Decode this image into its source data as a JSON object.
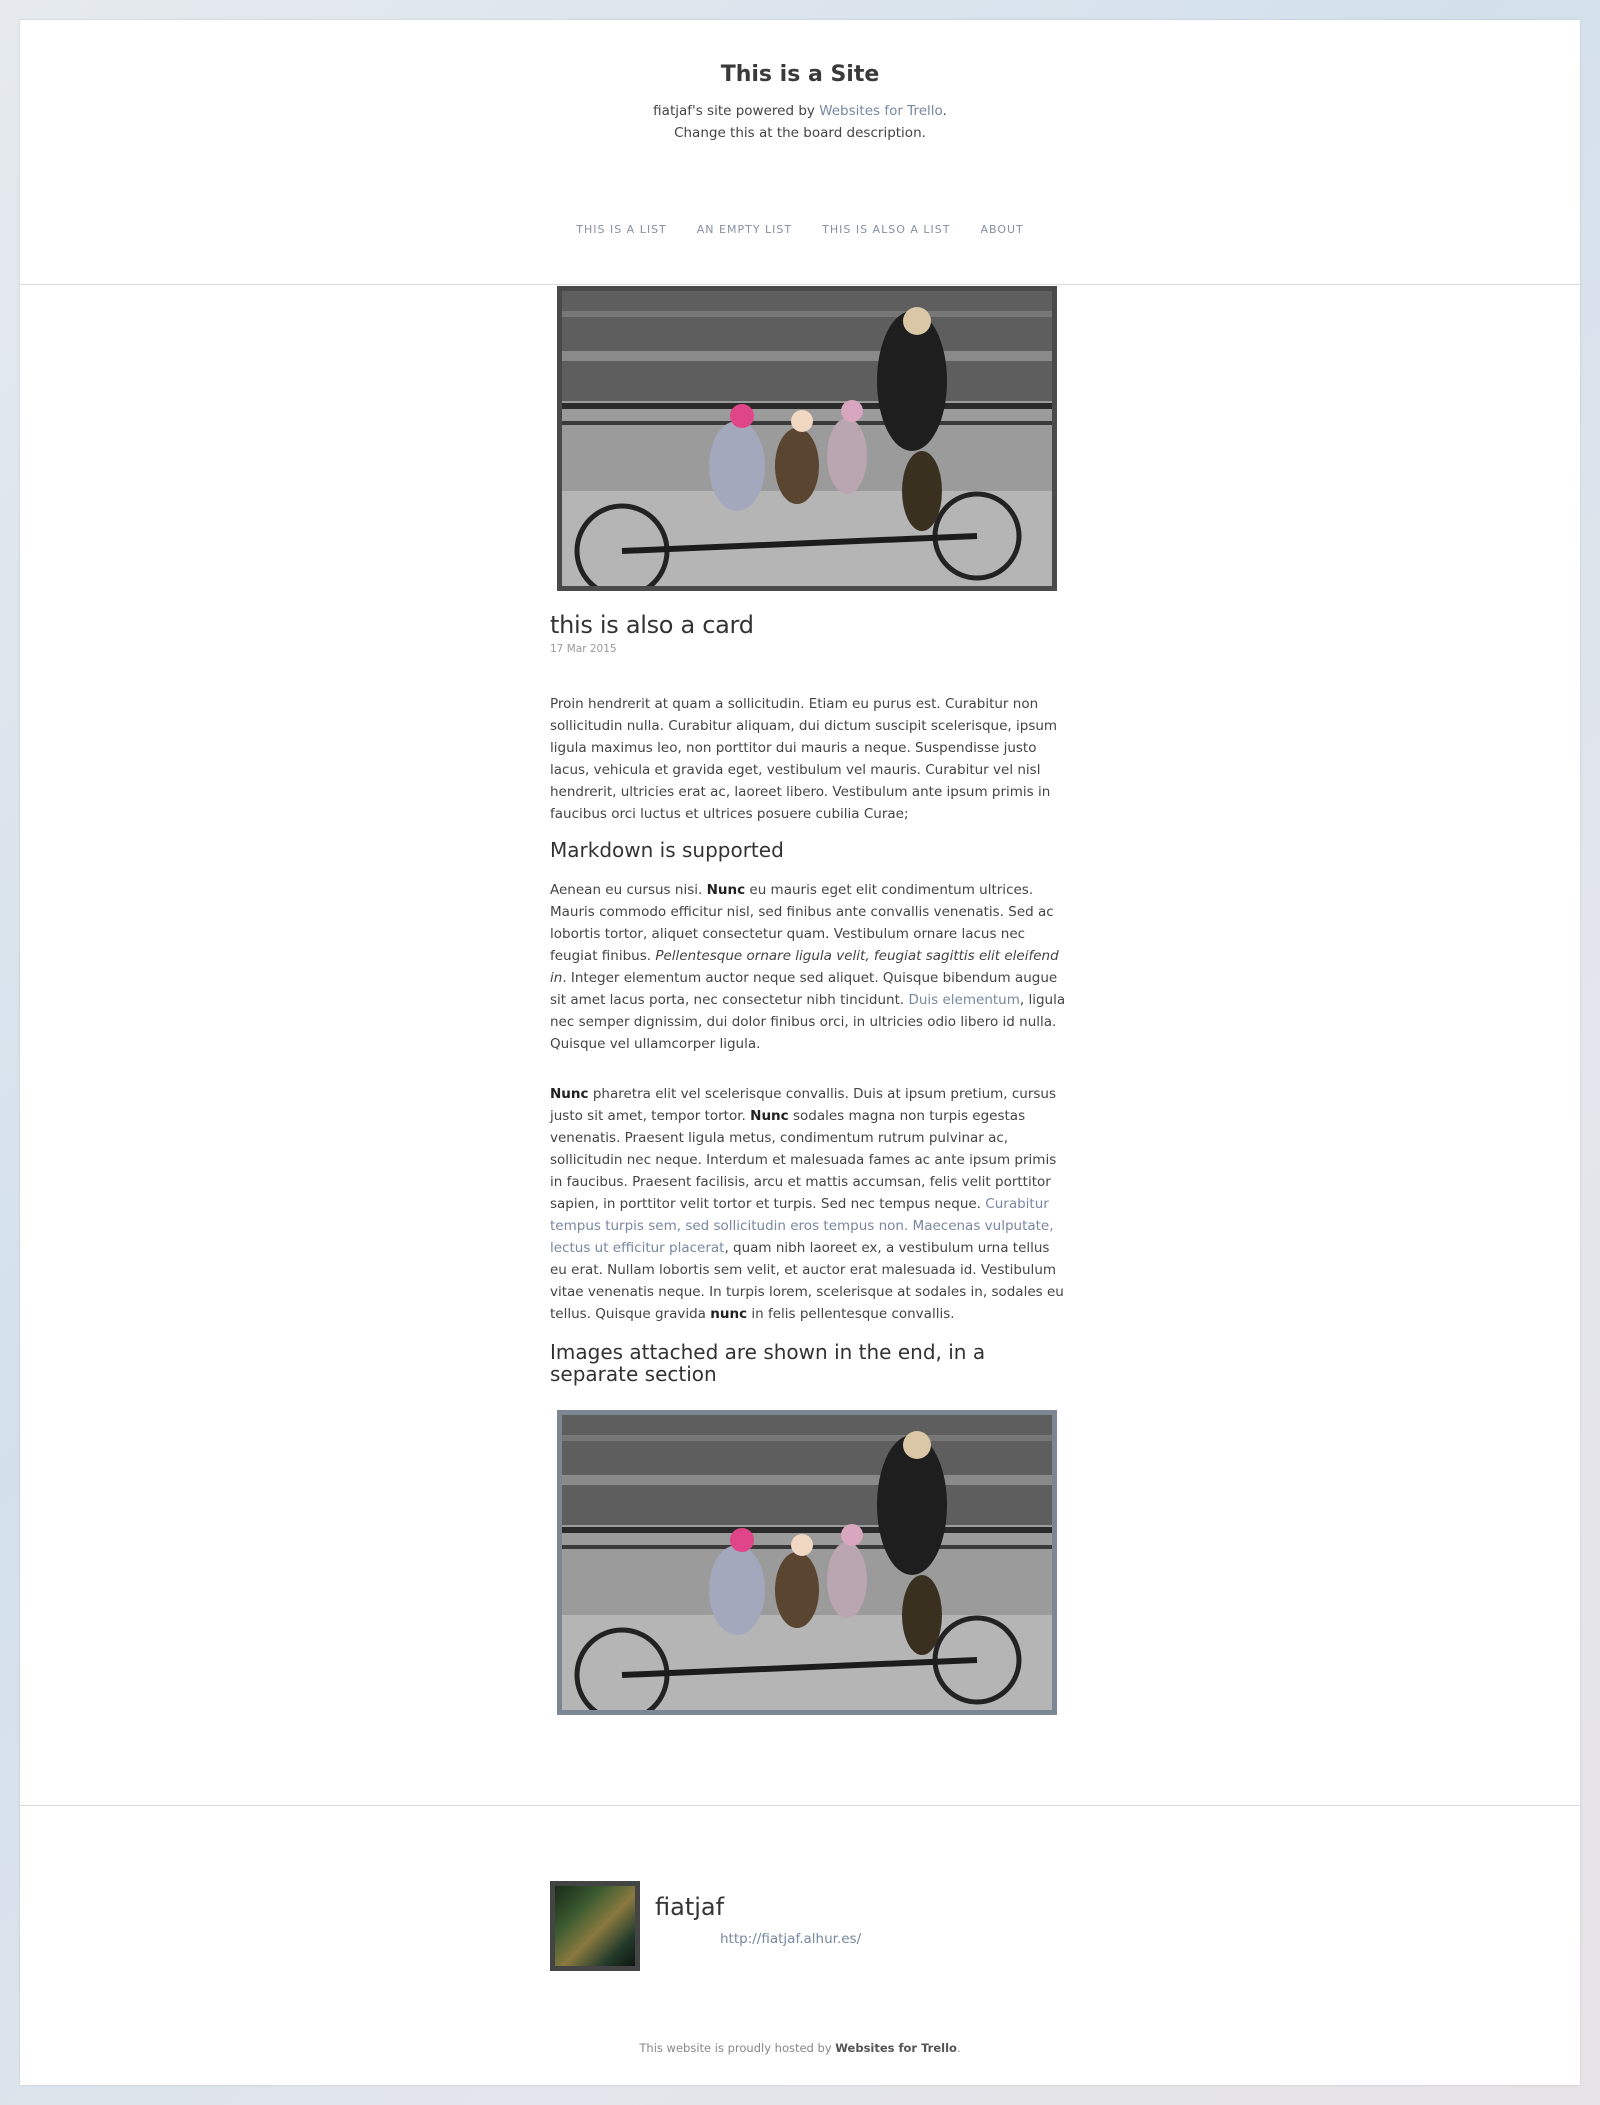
{
  "site": {
    "title": "This is a Site",
    "desc_prefix": "fiatjaf's site powered by ",
    "desc_link": "Websites for Trello",
    "desc_suffix": ".",
    "desc_line2": "Change this at the board description."
  },
  "nav": [
    "THIS IS A LIST",
    "AN EMPTY LIST",
    "THIS IS ALSO A LIST",
    "ABOUT"
  ],
  "card": {
    "title": "this is also a card",
    "date": "17 Mar 2015",
    "p1": "Proin hendrerit at quam a sollicitudin. Etiam eu purus est. Curabitur non sollicitudin nulla. Curabitur aliquam, dui dictum suscipit scelerisque, ipsum ligula maximus leo, non porttitor dui mauris a neque. Suspendisse justo lacus, vehicula et gravida eget, vestibulum vel mauris. Curabitur vel nisl hendrerit, ultricies erat ac, laoreet libero. Vestibulum ante ipsum primis in faucibus orci luctus et ultrices posuere cubilia Curae;",
    "h_markdown": "Markdown is supported",
    "p2_a": "Aenean eu cursus nisi. ",
    "p2_b": "Nunc",
    "p2_c": " eu mauris eget elit condimentum ultrices. Mauris commodo efficitur nisl, sed finibus ante convallis venenatis. Sed ac lobortis tortor, aliquet consectetur quam. Vestibulum ornare lacus nec feugiat finibus. ",
    "p2_d": "Pellentesque ornare ligula velit, feugiat sagittis elit eleifend in",
    "p2_e": ". Integer elementum auctor neque sed aliquet. Quisque bibendum augue sit amet lacus porta, nec consectetur nibh tincidunt. ",
    "p2_link": "Duis elementum",
    "p2_f": ", ligula nec semper dignissim, dui dolor finibus orci, in ultricies odio libero id nulla. Quisque vel ullamcorper ligula.",
    "p3_a": "Nunc",
    "p3_b": " pharetra elit vel scelerisque convallis. Duis at ipsum pretium, cursus justo sit amet, tempor tortor. ",
    "p3_c": "Nunc",
    "p3_d": " sodales magna non turpis egestas venenatis. Praesent ligula metus, condimentum rutrum pulvinar ac, sollicitudin nec neque. Interdum et malesuada fames ac ante ipsum primis in faucibus. Praesent facilisis, arcu et mattis accumsan, felis velit porttitor sapien, in porttitor velit tortor et turpis. Sed nec tempus neque. ",
    "p3_link": "Curabitur tempus turpis sem, sed sollicitudin eros tempus non. Maecenas vulputate, lectus ut efficitur placerat",
    "p3_e": ", quam nibh laoreet ex, a vestibulum urna tellus eu erat. Nullam lobortis sem velit, et auctor erat malesuada id. Vestibulum vitae venenatis neque. In turpis lorem, scelerisque at sodales in, sodales eu tellus. Quisque gravida ",
    "p3_f": "nunc",
    "p3_g": " in felis pellentesque convallis.",
    "h_images": "Images attached are shown in the end, in a separate section"
  },
  "author": {
    "name": "fiatjaf",
    "url": "http://fiatjaf.alhur.es/"
  },
  "footer": {
    "credit_prefix": "This website is proudly hosted by ",
    "credit_link": "Websites for Trello",
    "credit_suffix": "."
  },
  "colors": {
    "link": "#7788a0",
    "text": "#444444",
    "frame_dark": "#4a4a4a",
    "frame_blue": "#7d8794"
  }
}
